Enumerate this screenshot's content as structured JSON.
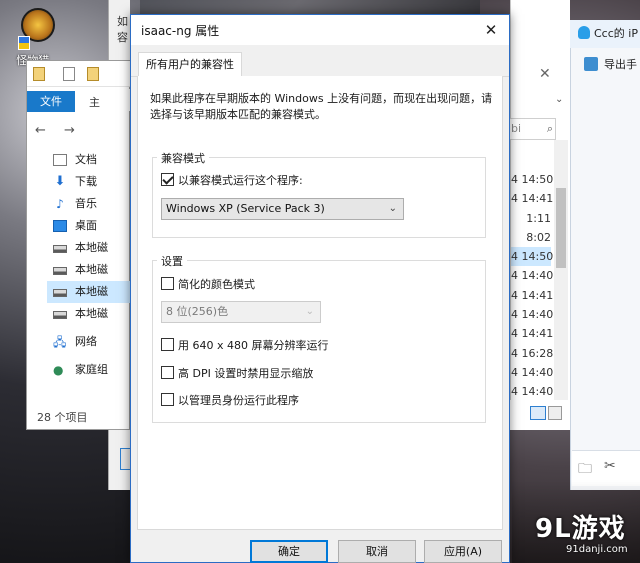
{
  "desktop": {
    "icon_label": "怪物猎..."
  },
  "explorer": {
    "ribbon_file": "文件",
    "ribbon_home": "主",
    "nav_back": "←",
    "nav_forward": "→",
    "nav_items": [
      "文档",
      "下载",
      "音乐",
      "桌面",
      "本地磁",
      "本地磁",
      "本地磁",
      "本地磁",
      "网络",
      "家庭组"
    ],
    "status": "28 个项目"
  },
  "background_dialog": {
    "text_line1": "如",
    "text_line2": "容",
    "link": "如"
  },
  "list_window": {
    "search_placeholder": "bi",
    "times": [
      "4 14:50",
      "4 14:41",
      "1:11",
      "8:02",
      "4 14:50",
      "4 14:40",
      "4 14:41",
      "4 14:40",
      "4 14:41",
      "4 16:28",
      "4 14:40",
      "4 14:40"
    ]
  },
  "qq": {
    "title": "Ccc的 iP",
    "export": "导出手"
  },
  "dialog": {
    "title": "isaac-ng 属性",
    "tab": "所有用户的兼容性",
    "intro": "如果此程序在早期版本的 Windows 上没有问题，而现在出现问题，请选择与该早期版本匹配的兼容模式。",
    "compat_group": "兼容模式",
    "compat_checkbox": "以兼容模式运行这个程序:",
    "compat_select": "Windows XP (Service Pack 3)",
    "settings_group": "设置",
    "reduced_color": "简化的颜色模式",
    "color_select": "8 位(256)色",
    "res_640": "用 640 x 480 屏幕分辨率运行",
    "dpi": "高 DPI 设置时禁用显示缩放",
    "admin": "以管理员身份运行此程序",
    "ok": "确定",
    "cancel": "取消",
    "apply": "应用(A)"
  },
  "watermark": {
    "logo": "9L游戏",
    "url": "91danji.com"
  }
}
